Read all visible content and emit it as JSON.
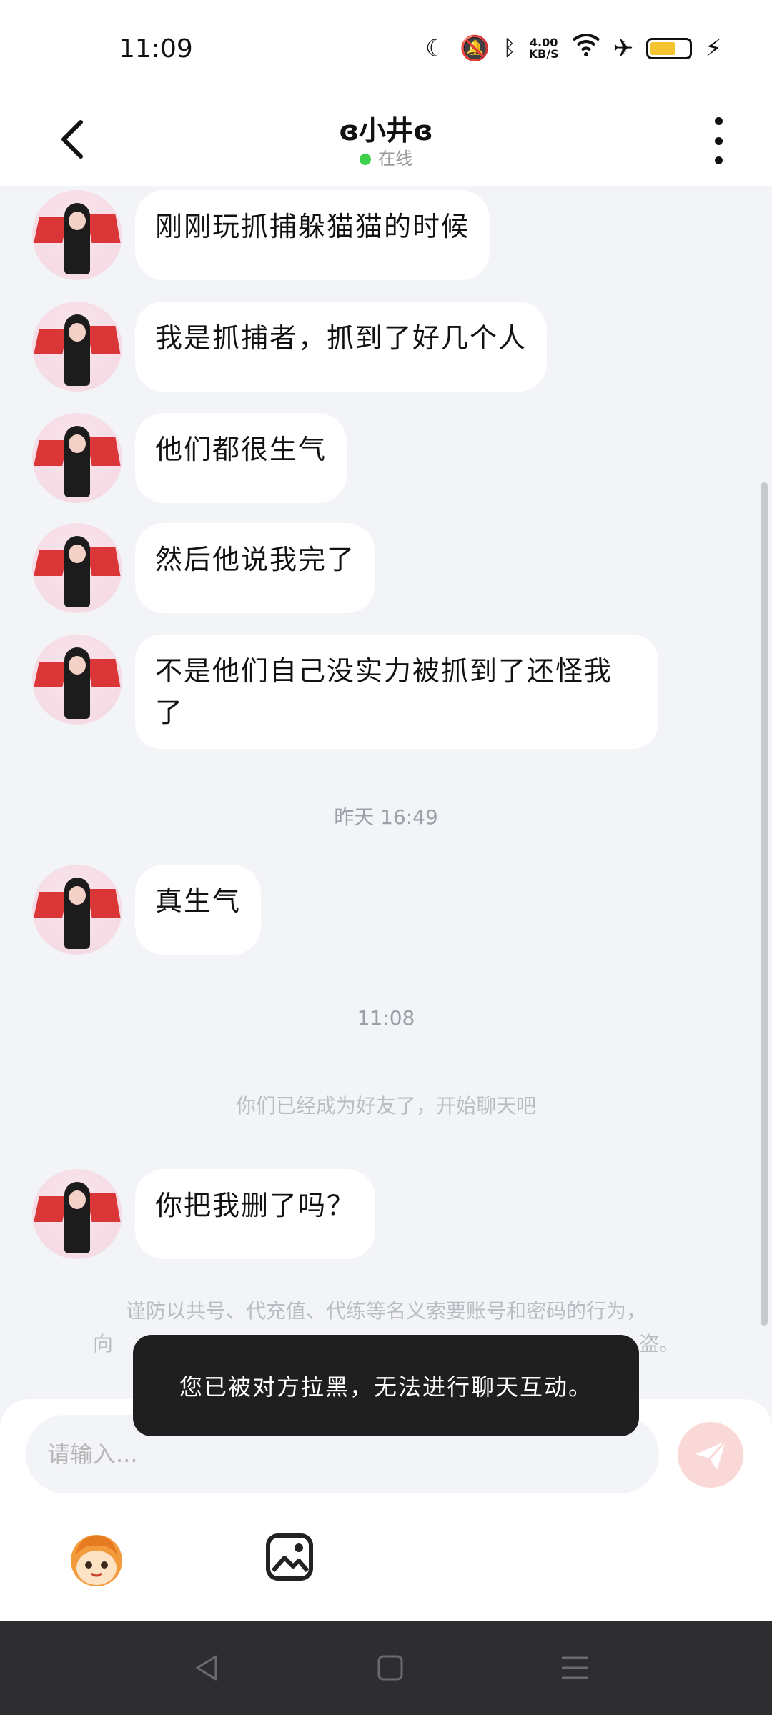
{
  "status_bar": {
    "time": "11:09",
    "network_speed_value": "4.00",
    "network_speed_unit": "KB/S",
    "battery_color": "#f5c431"
  },
  "header": {
    "title": "ɞ小井ɞ",
    "status": "在线",
    "online_color": "#3dd14b"
  },
  "messages": [
    {
      "text": "刚刚玩抓捕躲猫猫的时候"
    },
    {
      "text": "我是抓捕者，抓到了好几个人"
    },
    {
      "text": "他们都很生气"
    },
    {
      "text": "然后他说我完了"
    },
    {
      "text": "不是他们自己没实力被抓到了还怪我了"
    },
    {
      "text": "真生气"
    },
    {
      "text": "你把我删了吗？"
    }
  ],
  "timestamps": {
    "yesterday": "昨天 16:49",
    "today": "11:08"
  },
  "system_message": "你们已经成为好友了，开始聊天吧",
  "notice_line1": "谨防以共号、代充值、代练等名义索要账号和密码的行为，",
  "notice_line2_start": "向",
  "notice_line2_end": "盗。",
  "toast": "您已被对方拉黑，无法进行聊天互动。",
  "input": {
    "placeholder": "请输入..."
  },
  "icons": {
    "back": "back-arrow-icon",
    "more": "more-vertical-icon",
    "send": "send-icon",
    "emoji": "emoji-icon",
    "picture": "image-icon"
  }
}
